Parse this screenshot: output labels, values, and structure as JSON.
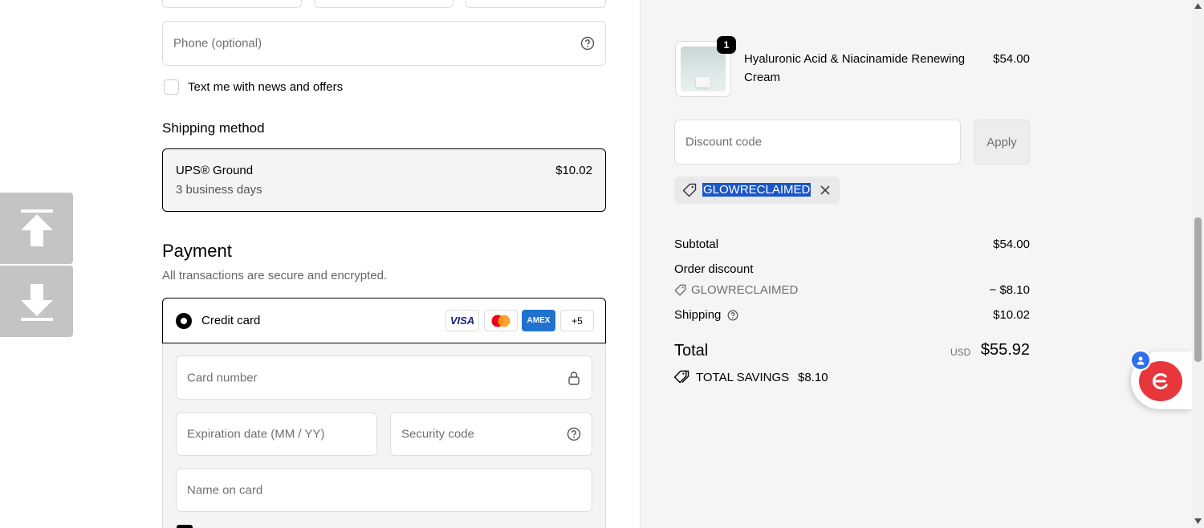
{
  "contact": {
    "phone_placeholder": "Phone (optional)",
    "news_label": "Text me with news and offers"
  },
  "shipping": {
    "heading": "Shipping method",
    "method_name": "UPS® Ground",
    "method_eta": "3 business days",
    "method_price": "$10.02"
  },
  "payment": {
    "heading": "Payment",
    "subheading": "All transactions are secure and encrypted.",
    "option_label": "Credit card",
    "card_logos": [
      "VISA",
      "Mastercard",
      "AMEX",
      "+5"
    ],
    "card_number_placeholder": "Card number",
    "expiry_placeholder": "Expiration date (MM / YY)",
    "security_placeholder": "Security code",
    "name_placeholder": "Name on card"
  },
  "summary": {
    "item": {
      "quantity": "1",
      "name_line1": "Hyaluronic Acid & Niacinamide Renewing",
      "name_line2": "Cream",
      "price": "$54.00"
    },
    "discount_placeholder": "Discount code",
    "apply_label": "Apply",
    "applied_code": "GLOWRECLAIMED",
    "subtotal_label": "Subtotal",
    "subtotal_value": "$54.00",
    "order_discount_label": "Order discount",
    "discount_code_label": "GLOWRECLAIMED",
    "discount_value": "− $8.10",
    "shipping_label": "Shipping",
    "shipping_value": "$10.02",
    "total_label": "Total",
    "currency": "USD",
    "total_value": "$55.92",
    "savings_label": "TOTAL SAVINGS",
    "savings_value": "$8.10"
  },
  "colors": {
    "accent_selected": "#1a56c5",
    "amex_blue": "#1f72cd",
    "chat_red": "#e8373c"
  },
  "icons": [
    "help-circle-icon",
    "lock-icon",
    "tag-icon",
    "close-icon",
    "arrow-up-icon",
    "arrow-down-icon",
    "chat-icon"
  ]
}
